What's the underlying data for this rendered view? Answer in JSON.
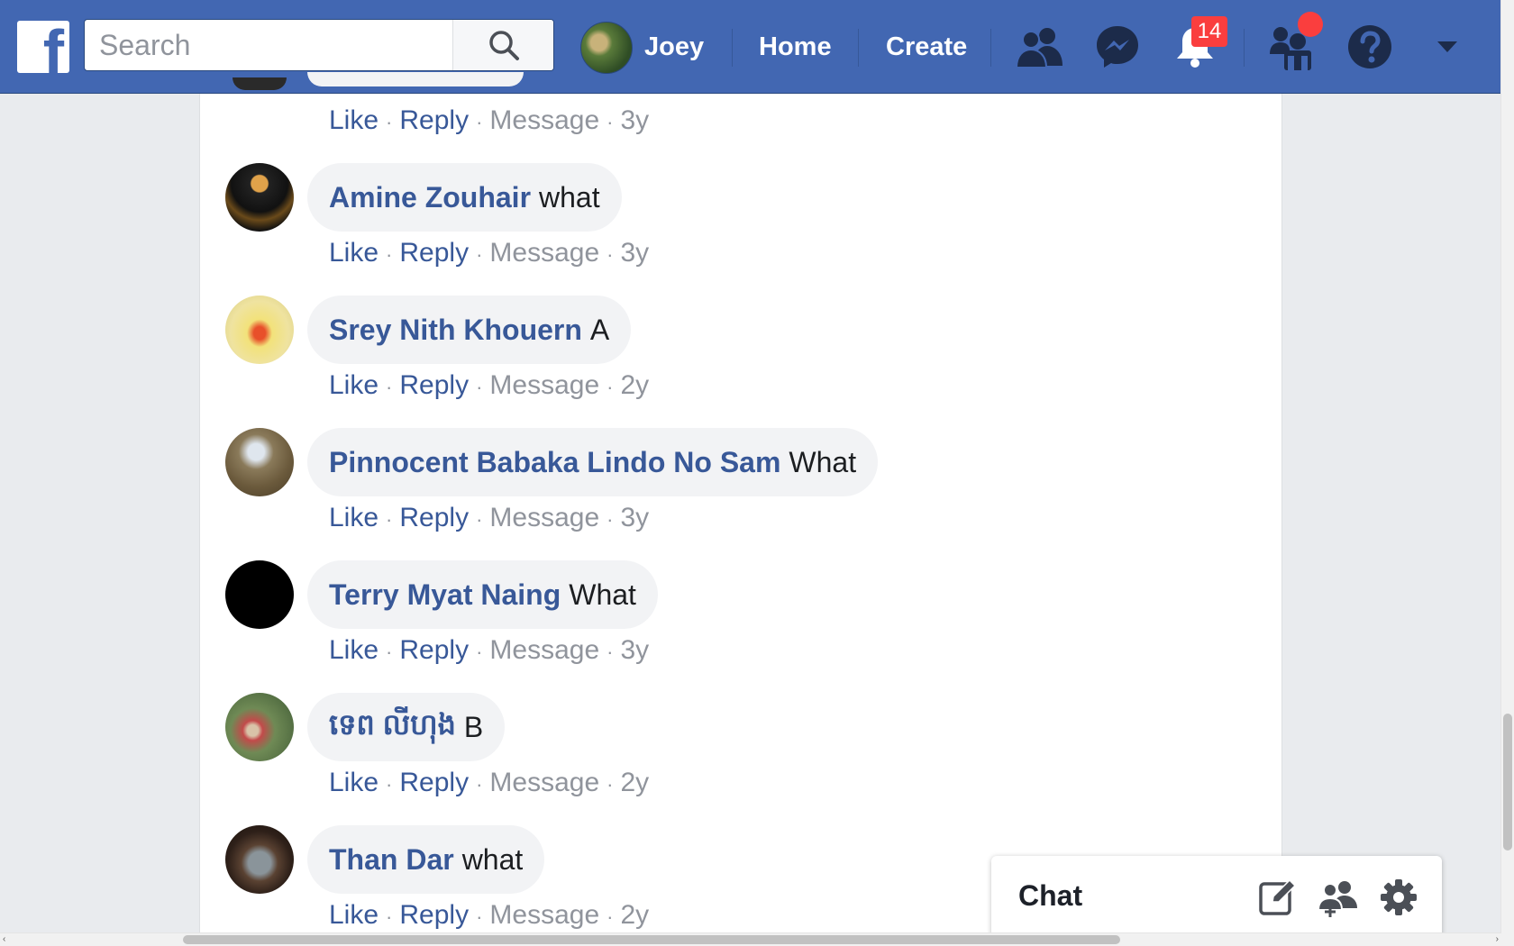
{
  "header": {
    "logo_letter": "f",
    "search_placeholder": "Search",
    "profile_name": "Joey",
    "home_label": "Home",
    "create_label": "Create",
    "notifications_count": "14",
    "brand_color": "#4267b2"
  },
  "top_partial_comment": {
    "actions": {
      "like": "Like",
      "reply": "Reply",
      "message": "Message",
      "time": "3y"
    }
  },
  "comments": [
    {
      "name": "Amine Zouhair",
      "text": "what",
      "like": "Like",
      "reply": "Reply",
      "message": "Message",
      "time": "3y"
    },
    {
      "name": "Srey Nith Khouern",
      "text": "A",
      "like": "Like",
      "reply": "Reply",
      "message": "Message",
      "time": "2y"
    },
    {
      "name": "Pinnocent Babaka Lindo No Sam",
      "text": "What",
      "like": "Like",
      "reply": "Reply",
      "message": "Message",
      "time": "3y"
    },
    {
      "name": "Terry Myat Naing",
      "text": "What",
      "like": "Like",
      "reply": "Reply",
      "message": "Message",
      "time": "3y"
    },
    {
      "name": "ទេព លីហុង",
      "text": "B",
      "like": "Like",
      "reply": "Reply",
      "message": "Message",
      "time": "2y"
    },
    {
      "name": "Than Dar",
      "text": "what",
      "like": "Like",
      "reply": "Reply",
      "message": "Message",
      "time": "2y"
    }
  ],
  "chat": {
    "title": "Chat",
    "icons": [
      "compose-icon",
      "new-group-icon",
      "settings-gear-icon"
    ]
  }
}
